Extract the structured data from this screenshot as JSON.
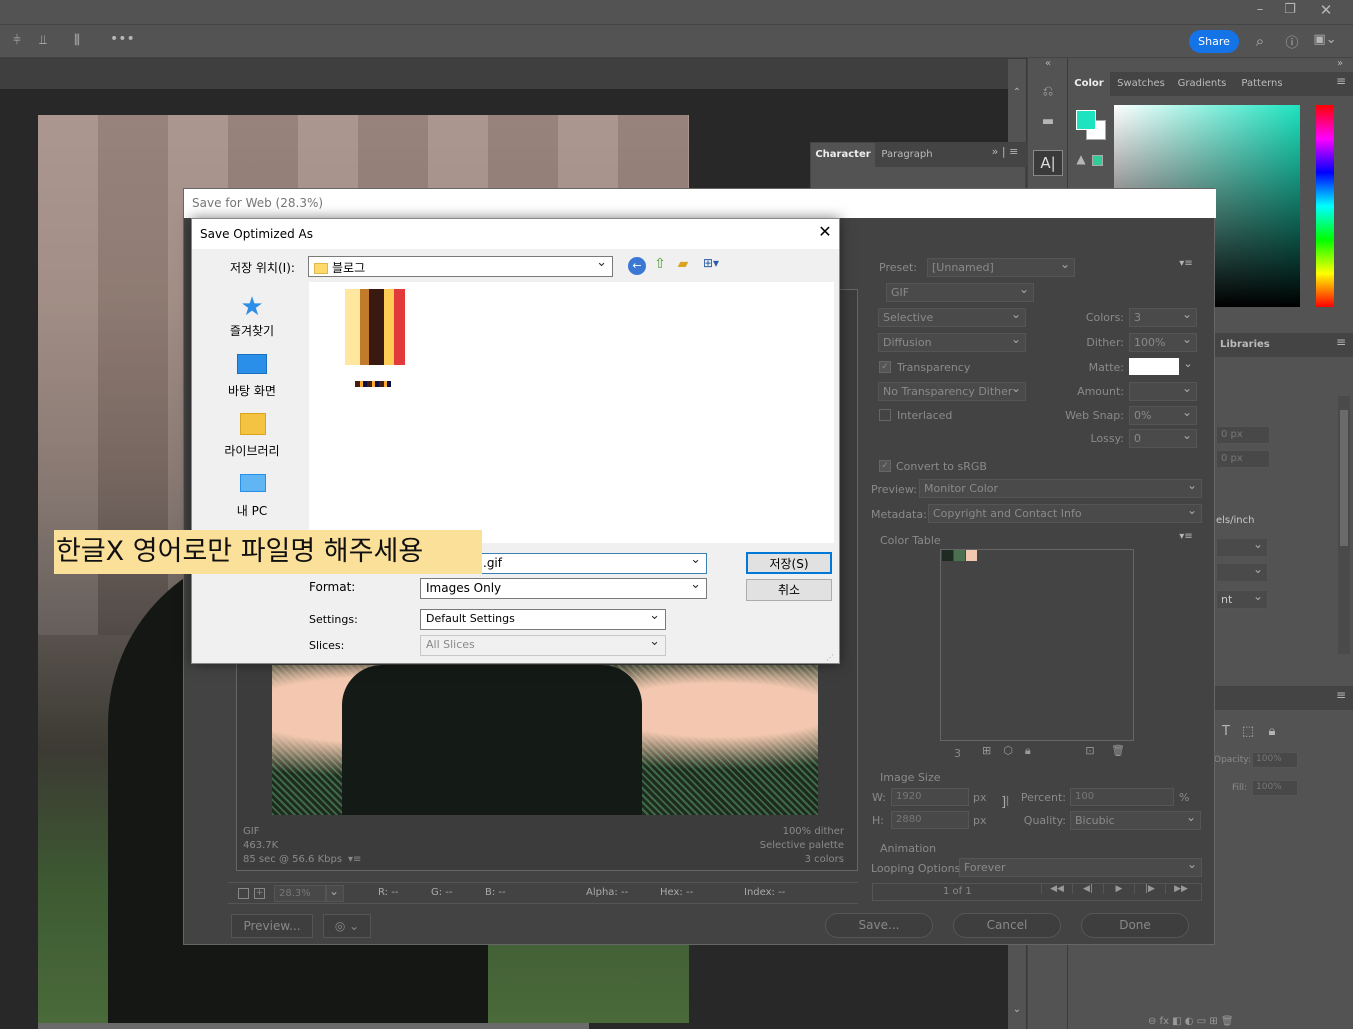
{
  "app": {
    "toolbar": {
      "share_label": "Share"
    },
    "colors": {
      "accent": "#1473e6",
      "bg": "#535353",
      "panel": "#4a4a4a"
    }
  },
  "color_panel": {
    "tabs": [
      "Color",
      "Swatches",
      "Gradients",
      "Patterns"
    ],
    "libraries_label": "Libraries",
    "foreground": "#1de3c0",
    "opacity_label": "Opacity:",
    "opacity_value": "100%",
    "fill_label": "Fill:",
    "fill_value": "100%",
    "partial_px1": "0 px",
    "partial_px2": "0 px",
    "partial_resolution": "els/inch",
    "partial_nt": "nt"
  },
  "character_panel": {
    "tabs": [
      "Character",
      "Paragraph"
    ]
  },
  "save_for_web": {
    "title": "Save for Web (28.3%)",
    "preset_label": "Preset:",
    "preset_value": "[Unnamed]",
    "format_value": "GIF",
    "reduction": "Selective",
    "dither_algo": "Diffusion",
    "transparency_label": "Transparency",
    "no_transparency_dither": "No Transparency Dither",
    "interlaced_label": "Interlaced",
    "colors_label": "Colors:",
    "colors_value": "3",
    "dither_label": "Dither:",
    "dither_value": "100%",
    "matte_label": "Matte:",
    "amount_label": "Amount:",
    "web_snap_label": "Web Snap:",
    "web_snap_value": "0%",
    "lossy_label": "Lossy:",
    "lossy_value": "0",
    "convert_srgb_label": "Convert to sRGB",
    "preview_label": "Preview:",
    "preview_value": "Monitor Color",
    "metadata_label": "Metadata:",
    "metadata_value": "Copyright and Contact Info",
    "color_table_label": "Color Table",
    "color_table_count": "3",
    "color_table_colors": [
      "#1f2a22",
      "#4a7050",
      "#f2c8b0"
    ],
    "image_size_label": "Image Size",
    "w_label": "W:",
    "w_value": "1920",
    "h_label": "H:",
    "h_value": "2880",
    "px_unit": "px",
    "percent_label": "Percent:",
    "percent_value": "100",
    "percent_unit": "%",
    "quality_label": "Quality:",
    "quality_value": "Bicubic",
    "animation_label": "Animation",
    "looping_label": "Looping Options:",
    "looping_value": "Forever",
    "frame_counter": "1 of 1",
    "info_left": [
      "GIF",
      "463.7K",
      "85 sec @ 56.6 Kbps"
    ],
    "info_right": [
      "100% dither",
      "Selective palette",
      "3 colors"
    ],
    "zoom_value": "28.3%",
    "status": {
      "r": "R: --",
      "g": "G: --",
      "b": "B: --",
      "alpha": "Alpha: --",
      "hex": "Hex: --",
      "index": "Index: --"
    },
    "preview_button": "Preview...",
    "save_button": "Save...",
    "cancel_button": "Cancel",
    "done_button": "Done"
  },
  "save_dialog": {
    "title": "Save Optimized As",
    "location_label": "저장 위치(I):",
    "location_value": "블로그",
    "nav": [
      {
        "label": "즐겨찾기",
        "icon": "star-icon"
      },
      {
        "label": "바탕 화면",
        "icon": "desktop-icon"
      },
      {
        "label": "라이브러리",
        "icon": "library-icon"
      },
      {
        "label": "내 PC",
        "icon": "pc-icon"
      }
    ],
    "filename_value": ".gif",
    "format_label": "Format:",
    "format_value": "Images Only",
    "settings_label": "Settings:",
    "settings_value": "Default Settings",
    "slices_label": "Slices:",
    "slices_value": "All Slices",
    "save_button": "저장(S)",
    "cancel_button": "취소"
  },
  "annotation": {
    "text": "한글X 영어로만 파일명 해주세용"
  }
}
